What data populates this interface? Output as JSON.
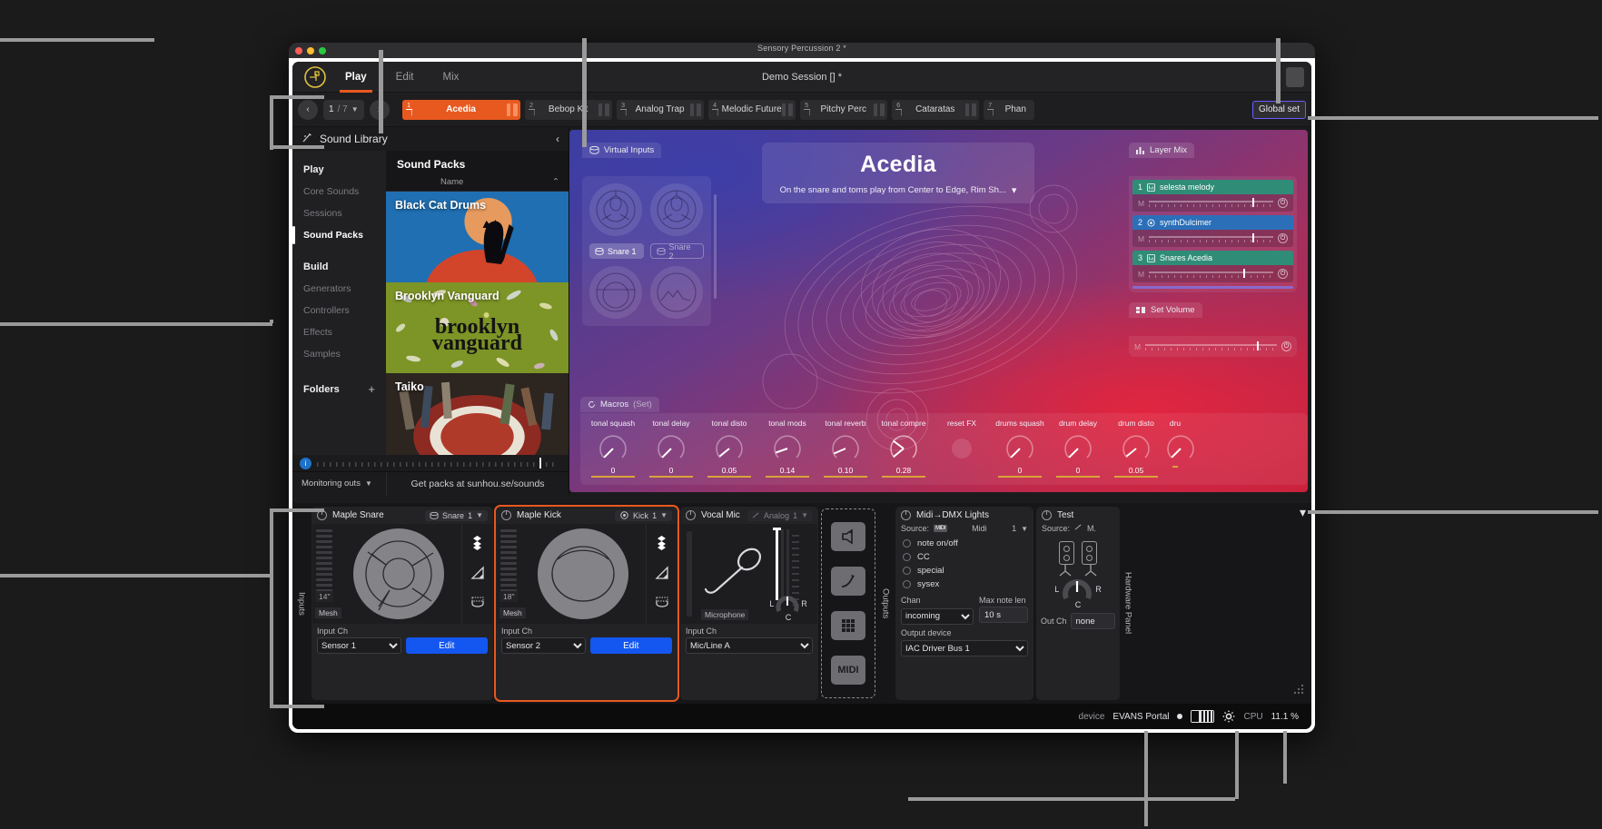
{
  "window": {
    "mac_title": "Sensory Percussion 2 *"
  },
  "topbar": {
    "tabs": [
      {
        "label": "Play",
        "active": true
      },
      {
        "label": "Edit",
        "active": false
      },
      {
        "label": "Mix",
        "active": false
      }
    ],
    "session_title": "Demo Session [] *"
  },
  "kitbar": {
    "prev": "‹",
    "next": "›",
    "page_current": "1",
    "page_total": "/ 7",
    "global_set_label": "Global set",
    "kits": [
      {
        "num": "1",
        "name": "Acedia",
        "selected": true
      },
      {
        "num": "2",
        "name": "Bebop Kit",
        "selected": false
      },
      {
        "num": "3",
        "name": "Analog Trap",
        "selected": false
      },
      {
        "num": "4",
        "name": "Melodic Future",
        "selected": false
      },
      {
        "num": "5",
        "name": "Pitchy Perc",
        "selected": false
      },
      {
        "num": "6",
        "name": "Cataratas",
        "selected": false
      },
      {
        "num": "7",
        "name": "Phan",
        "selected": false
      }
    ]
  },
  "library": {
    "title": "Sound Library",
    "nav": {
      "play_header": "Play",
      "play_items": [
        {
          "label": "Core Sounds",
          "active": false
        },
        {
          "label": "Sessions",
          "active": false
        },
        {
          "label": "Sound Packs",
          "active": true
        }
      ],
      "build_header": "Build",
      "build_items": [
        {
          "label": "Generators",
          "active": false
        },
        {
          "label": "Controllers",
          "active": false
        },
        {
          "label": "Effects",
          "active": false
        },
        {
          "label": "Samples",
          "active": false
        }
      ],
      "folders_header": "Folders",
      "folders_add": "+"
    },
    "content_title": "Sound Packs",
    "column_header": "Name",
    "sort_arrow": "⌃",
    "packs": [
      {
        "name": "Black Cat Drums"
      },
      {
        "name": "Brooklyn Vanguard"
      },
      {
        "name": "Taiko"
      }
    ],
    "monitoring_outs": "Monitoring outs",
    "get_packs": "Get packs at sunhou.se/sounds"
  },
  "stage": {
    "virtual_inputs_label": "Virtual Inputs",
    "virtual_buttons": [
      {
        "label": "Snare 1",
        "active": true
      },
      {
        "label": "Snare 2",
        "active": false
      }
    ],
    "kit_name": "Acedia",
    "kit_description": "On the snare and toms play from Center to Edge, Rim Sh...",
    "layer_mix": {
      "title": "Layer Mix",
      "layers": [
        {
          "num": "1",
          "name": "selesta melody",
          "color": "#2f8d77",
          "mute": "M",
          "level": 83
        },
        {
          "num": "2",
          "name": "synthDulcimer",
          "color": "#2b6fb8",
          "mute": "M",
          "level": 83
        },
        {
          "num": "3",
          "name": "Snares Acedia",
          "color": "#2f8d77",
          "mute": "M",
          "level": 76
        }
      ]
    },
    "set_volume": {
      "title": "Set Volume",
      "mute": "M",
      "level": 85
    },
    "macros": {
      "title": "Macros",
      "suffix": "(Set)",
      "items": [
        {
          "label": "tonal squash",
          "value": "0",
          "angle": -125
        },
        {
          "label": "tonal delay",
          "value": "0",
          "angle": -125
        },
        {
          "label": "tonal disto",
          "value": "0.05",
          "angle": -118
        },
        {
          "label": "tonal mods",
          "value": "0.14",
          "angle": -155
        },
        {
          "label": "tonal reverb",
          "value": "0.10",
          "angle": -148
        },
        {
          "label": "tonal compre",
          "value": "0.28",
          "angle": -175
        },
        {
          "label": "reset FX",
          "value": "",
          "angle": null
        },
        {
          "label": "drums squash",
          "value": "0",
          "angle": -125
        },
        {
          "label": "drum delay",
          "value": "0",
          "angle": -125
        },
        {
          "label": "drum disto",
          "value": "0.05",
          "angle": -118
        },
        {
          "label": "dru",
          "value": "",
          "angle": -125
        }
      ]
    }
  },
  "hardware": {
    "inputs_label": "Inputs",
    "outputs_label": "Outputs",
    "hardware_panel_label": "Hardware Panel",
    "devices": [
      {
        "name": "Maple Snare",
        "badge_icon": "drum-icon",
        "badge_text": "Snare",
        "badge_num": "1",
        "size": "14\"",
        "head": "Mesh",
        "input_label": "Input Ch",
        "input_value": "Sensor 1",
        "edit": "Edit",
        "selected": false,
        "shape": "snare"
      },
      {
        "name": "Maple Kick",
        "badge_icon": "kick-icon",
        "badge_text": "Kick",
        "badge_num": "1",
        "size": "18\"",
        "head": "Mesh",
        "input_label": "Input Ch",
        "input_value": "Sensor 2",
        "edit": "Edit",
        "selected": true,
        "shape": "kick"
      }
    ],
    "vocal": {
      "name": "Vocal Mic",
      "badge_text": "Analog",
      "badge_num": "1",
      "type_label": "Microphone",
      "input_label": "Input Ch",
      "input_value": "Mic/Line A",
      "pan_left": "L",
      "pan_right": "R",
      "pan_center": "C"
    },
    "addbuttons": [
      "speaker-icon",
      "cable-icon",
      "grid-icon",
      "MIDI"
    ],
    "mididmx": {
      "name": "Midi→DMX Lights",
      "source_label": "Source:",
      "source_icon": "MIDI",
      "source_value": "Midi",
      "source_num": "1",
      "options": [
        {
          "label": "note on/off",
          "selected": false
        },
        {
          "label": "CC",
          "selected": false
        },
        {
          "label": "special",
          "selected": false
        },
        {
          "label": "sysex",
          "selected": false
        }
      ],
      "chan_label": "Chan",
      "chan_value": "incoming",
      "maxnote_label": "Max note len",
      "maxnote_value": "10 s",
      "outdev_label": "Output device",
      "outdev_value": "IAC Driver Bus 1"
    },
    "test": {
      "name": "Test",
      "source_label": "Source:",
      "source_value": "M.",
      "pan_left": "L",
      "pan_right": "R",
      "pan_center": "C",
      "outch_label": "Out Ch",
      "outch_value": "none"
    }
  },
  "status": {
    "device_label": "device",
    "device_name": "EVANS Portal",
    "cpu_label": "CPU",
    "cpu_value": "11.1 %"
  }
}
